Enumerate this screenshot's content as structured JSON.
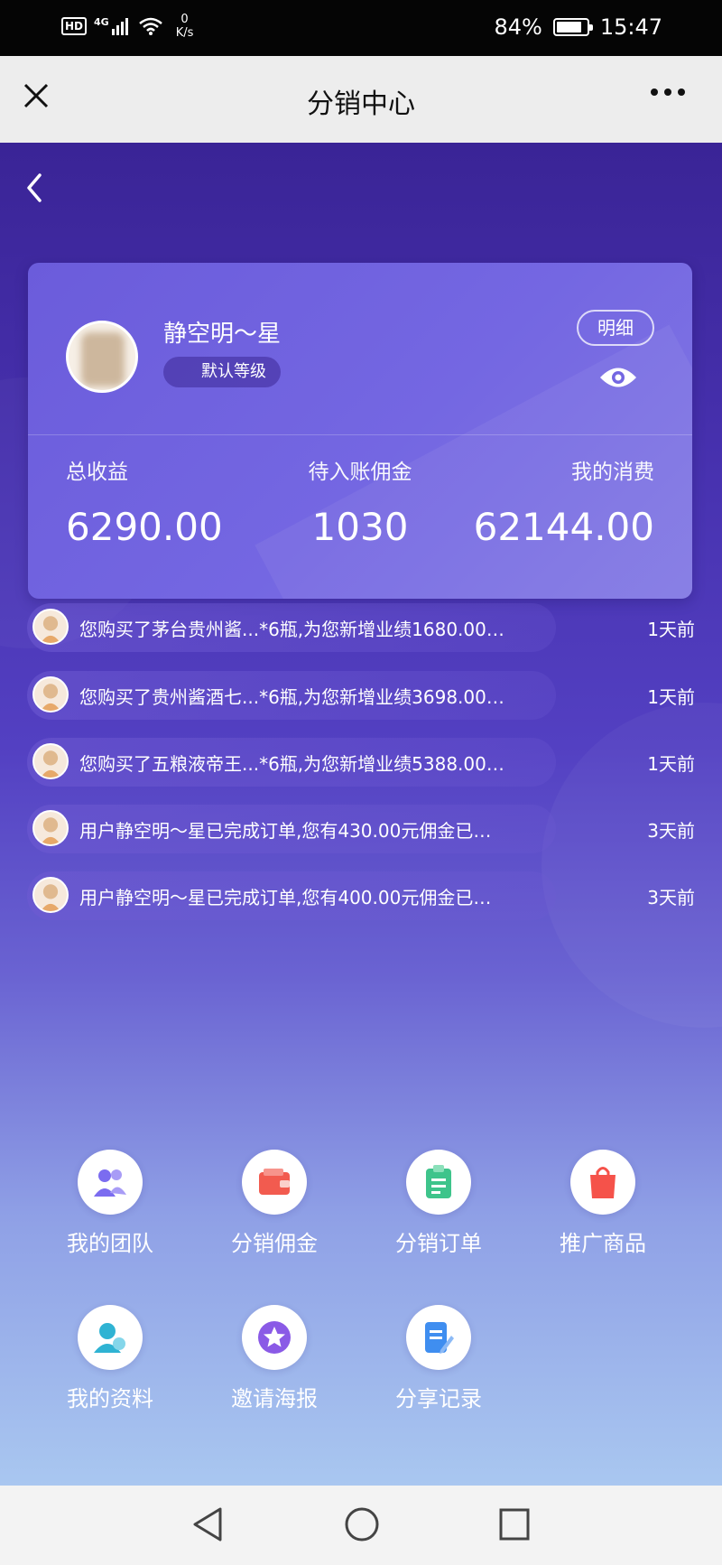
{
  "status_bar": {
    "hd": "HD",
    "network": "4G",
    "net_speed_value": "0",
    "net_speed_unit": "K/s",
    "battery": "84%",
    "battery_level": 0.84,
    "time": "15:47"
  },
  "title_bar": {
    "title": "分销中心"
  },
  "profile": {
    "username": "静空明～星",
    "level": "默认等级",
    "detail_button": "明细"
  },
  "stats": [
    {
      "label": "总收益",
      "value": "6290.00"
    },
    {
      "label": "待入账佣金",
      "value": "1030"
    },
    {
      "label": "我的消费",
      "value": "62144.00"
    }
  ],
  "messages": [
    {
      "text": "您购买了茅台贵州酱...*6瓶,为您新增业绩1680.00…",
      "time": "1天前"
    },
    {
      "text": "您购买了贵州酱酒七...*6瓶,为您新增业绩3698.00…",
      "time": "1天前"
    },
    {
      "text": "您购买了五粮液帝王...*6瓶,为您新增业绩5388.00…",
      "time": "1天前"
    },
    {
      "text": "用户静空明～星已完成订单,您有430.00元佣金已…",
      "time": "3天前"
    },
    {
      "text": "用户静空明～星已完成订单,您有400.00元佣金已…",
      "time": "3天前"
    }
  ],
  "menu": [
    {
      "label": "我的团队",
      "icon": "team-icon",
      "color": "#7b6cf0"
    },
    {
      "label": "分销佣金",
      "icon": "wallet-icon",
      "color": "#f25b4f"
    },
    {
      "label": "分销订单",
      "icon": "clipboard-icon",
      "color": "#3ec48b"
    },
    {
      "label": "推广商品",
      "icon": "shopping-bag-icon",
      "color": "#f5524a"
    },
    {
      "label": "我的资料",
      "icon": "profile-icon",
      "color": "#2fb3d3"
    },
    {
      "label": "邀请海报",
      "icon": "star-badge-icon",
      "color": "#8a5ae6"
    },
    {
      "label": "分享记录",
      "icon": "edit-doc-icon",
      "color": "#3f8ef0"
    }
  ]
}
